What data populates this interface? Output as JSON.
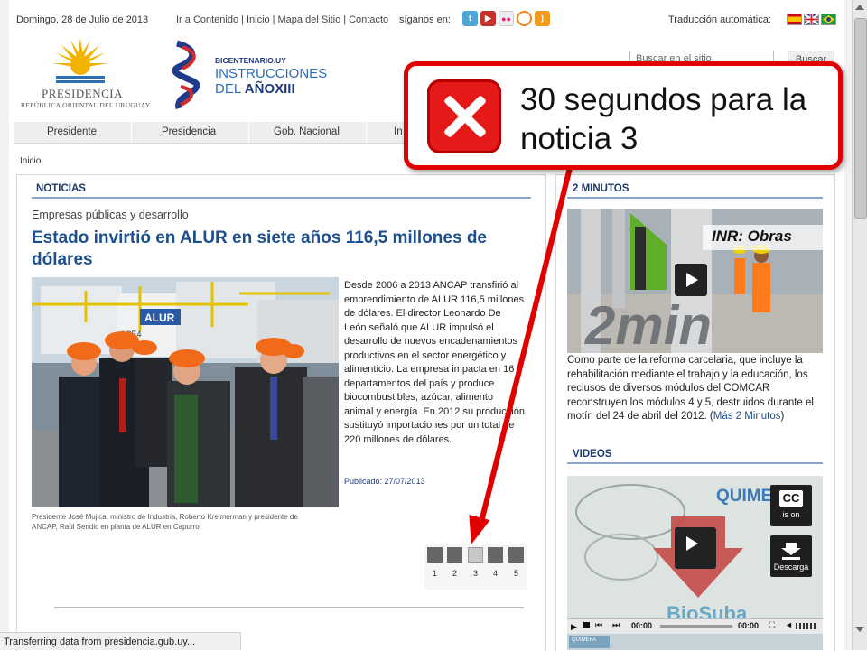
{
  "topbar": {
    "date": "Domingo, 28 de Julio de 2013",
    "links": [
      "Ir a Contenido",
      "Inicio",
      "Mapa del Sitio",
      "Contacto"
    ],
    "follow_label": "síganos en:",
    "social_icons": [
      "twitter-icon",
      "youtube-icon",
      "flickr-icon",
      "circle-icon",
      "rss-icon"
    ],
    "translate_label": "Traducción automática:",
    "flags": [
      "spain-flag-icon",
      "uk-flag-icon",
      "brazil-flag-icon"
    ]
  },
  "logos": {
    "presidencia_title": "PRESIDENCIA",
    "presidencia_subtitle": "REPÚBLICA ORIENTAL DEL URUGUAY",
    "bic_line1": "BICENTENARIO.UY",
    "bic_line2": "INSTRUCCIONES",
    "bic_line3a": "DEL ",
    "bic_line3b": "AÑOXIII"
  },
  "search": {
    "placeholder": "Buscar en el sitio",
    "button": "Buscar"
  },
  "nav": [
    "Presidente",
    "Presidencia",
    "Gob. Nacional",
    "In"
  ],
  "breadcrumb": "Inicio",
  "news": {
    "section": "NOTICIAS",
    "category": "Empresas públicas y desarrollo",
    "headline": "Estado invirtió en ALUR en siete años 116,5 millones de dólares",
    "body": "Desde 2006 a 2013 ANCAP transfirió al emprendimiento de ALUR 116,5 millones de dólares. El director Leonardo De León señaló que ALUR impulsó el desarrollo de nuevos encadenamientos productivos en el sector energético y alimenticio. La empresa impacta en 16 departamentos del país y produce biocombustibles, azúcar, alimento animal y energía. En 2012 su producción sustituyó importaciones por un total de 220 millones de dólares.",
    "published": "Publicado: 27/07/2013",
    "caption": "Presidente José Mujica, ministro de Industria, Roberto Kreimerman y presidente de ANCAP, Raúl Sendic en planta de ALUR en Capurro",
    "photo_sign": "ALUR",
    "photo_tank": "ACE4",
    "pager": [
      "1",
      "2",
      "3",
      "4",
      "5"
    ],
    "pager_active": 3
  },
  "side": {
    "section1": "2 MINUTOS",
    "video1_title": "INR: Obras",
    "video1_overlay": "2min",
    "text": "Como parte de la reforma carcelaria, que incluye la rehabilitación mediante el trabajo y la educación, los reclusos de diversos módulos del COMCAR reconstruyen los módulos 4 y 5, destruidos durante el motín del 24 de abril del 2012. (",
    "link": "Más 2 Minutos",
    "text_end": ")",
    "section2": "VIDEOS",
    "video2_word": "QUIMEF",
    "video2_logo": "BioSuba",
    "cc_label": "CC",
    "cc_sub": "is on",
    "download_label": "Descarga",
    "time_start": "00:00",
    "time_end": "00:00",
    "thumb_label": "QUIMEFA"
  },
  "status": "Transferring data from presidencia.gub.uy...",
  "callout": {
    "message": "30 segundos para la noticia 3"
  }
}
